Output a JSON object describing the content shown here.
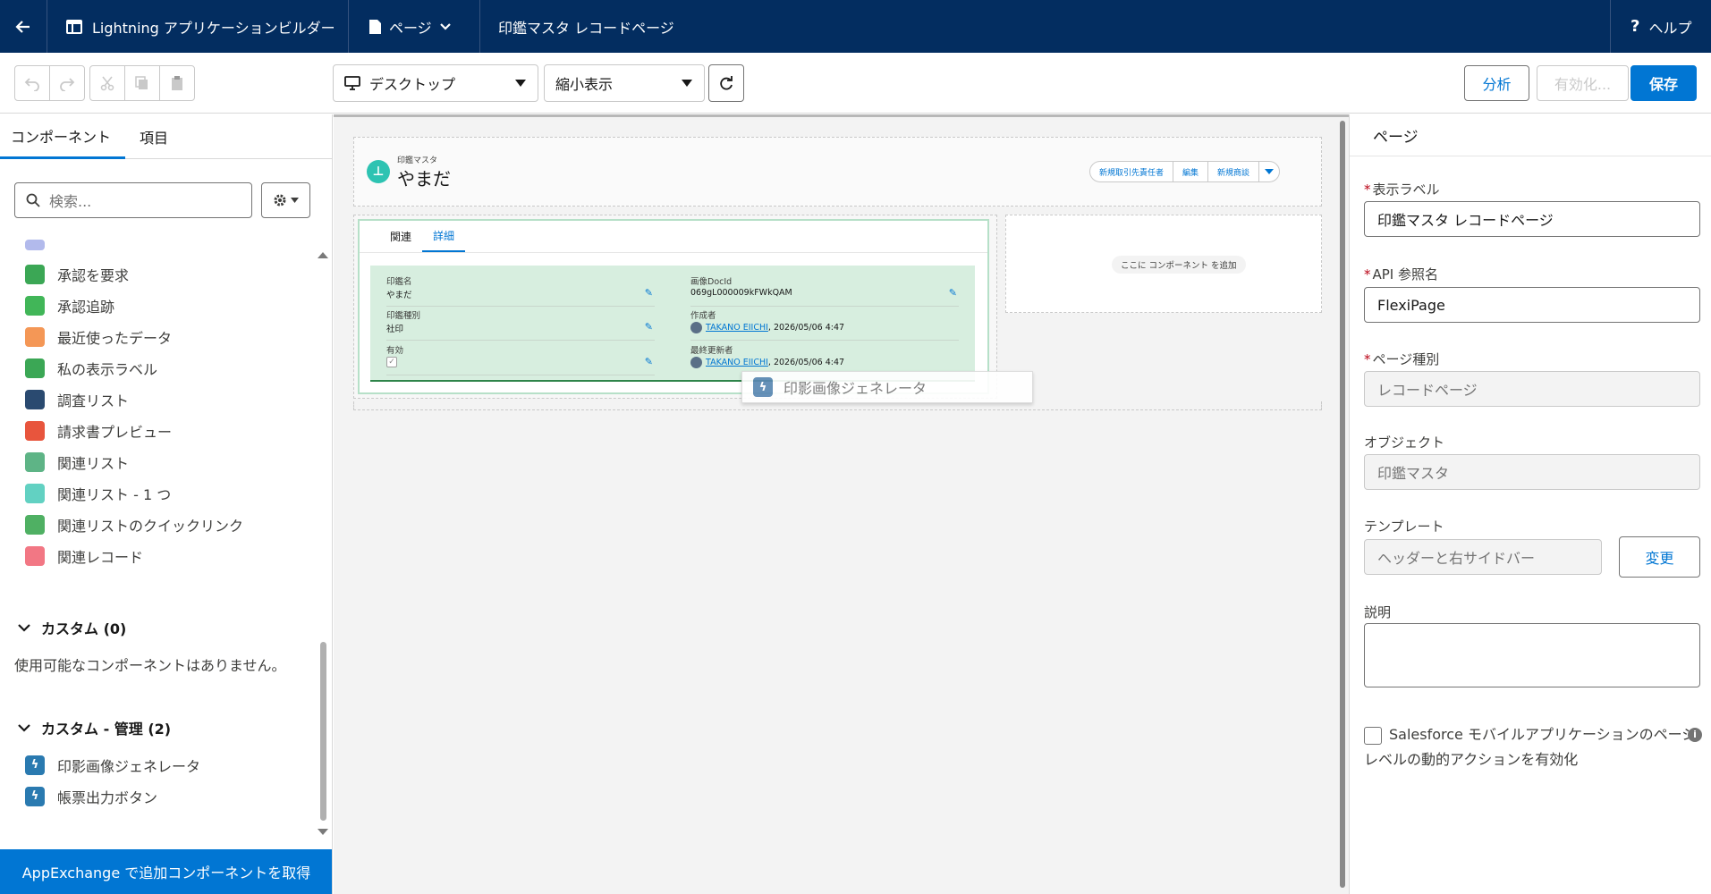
{
  "topbar": {
    "app_name": "Lightning アプリケーションビルダー",
    "page_menu": "ページ",
    "page_title": "印鑑マスタ レコードページ",
    "help": "ヘルプ",
    "bg_color": "#032d60"
  },
  "toolbar": {
    "device_select": "デスクトップ",
    "zoom_select": "縮小表示",
    "analyze": "分析",
    "activate": "有効化...",
    "save": "保存",
    "accent_color": "#0176d3"
  },
  "left": {
    "tabs": [
      "コンポーネント",
      "項目"
    ],
    "search_placeholder": "検索...",
    "items": [
      {
        "label": "承認を要求",
        "icon": "approval-icon",
        "color": "#3ba755"
      },
      {
        "label": "承認追跡",
        "icon": "clipboard-icon",
        "color": "#41b658"
      },
      {
        "label": "最近使ったデータ",
        "icon": "clock-icon",
        "color": "#f49756"
      },
      {
        "label": "私の表示ラベル",
        "icon": "tag-icon",
        "color": "#3ba755"
      },
      {
        "label": "調査リスト",
        "icon": "checkbox-icon",
        "color": "#2a4a70"
      },
      {
        "label": "請求書プレビュー",
        "icon": "invoice-icon",
        "color": "#e8553d"
      },
      {
        "label": "関連リスト",
        "icon": "related-list-icon",
        "color": "#5eb486"
      },
      {
        "label": "関連リスト - 1 つ",
        "icon": "related-list-single-icon",
        "color": "#62d1c2"
      },
      {
        "label": "関連リストのクイックリンク",
        "icon": "quick-links-icon",
        "color": "#4fb063"
      },
      {
        "label": "関連レコード",
        "icon": "related-record-icon",
        "color": "#f27784"
      }
    ],
    "custom_header": "カスタム (0)",
    "custom_empty": "使用可能なコンポーネントはありません。",
    "custom_managed_header": "カスタム - 管理 (2)",
    "custom_managed_items": [
      {
        "label": "印影画像ジェネレータ",
        "icon": "lightning-icon",
        "color": "#2a7ab0"
      },
      {
        "label": "帳票出力ボタン",
        "icon": "lightning-icon",
        "color": "#2a7ab0"
      }
    ],
    "appexchange": "AppExchange で追加コンポーネントを取得"
  },
  "canvas": {
    "highlights": {
      "object_label": "印鑑マスタ",
      "record_name": "やまだ",
      "actions": [
        "新規取引先責任者",
        "編集",
        "新規商談"
      ]
    },
    "tabs": [
      "関連",
      "詳細"
    ],
    "fields": {
      "name_label": "印鑑名",
      "name_value": "やまだ",
      "type_label": "印鑑種別",
      "type_value": "社印",
      "active_label": "有効",
      "docid_label": "画像DocId",
      "docid_value": "069gL000009kFWkQAM",
      "creator_label": "作成者",
      "creator_user": "TAKANO EIICHI",
      "creator_date": ", 2026/05/06 4:47",
      "modifier_label": "最終更新者",
      "modifier_user": "TAKANO EIICHI",
      "modifier_date": ", 2026/05/06 4:47"
    },
    "add_component": "ここに コンポーネント を追加",
    "drag_ghost": "印影画像ジェネレータ"
  },
  "right": {
    "header": "ページ",
    "label_label": "表示ラベル",
    "label_value": "印鑑マスタ レコードページ",
    "api_label": "API 参照名",
    "api_value": "FlexiPage",
    "type_label": "ページ種別",
    "type_value": "レコードページ",
    "object_label": "オブジェクト",
    "object_value": "印鑑マスタ",
    "template_label": "テンプレート",
    "template_value": "ヘッダーと右サイドバー",
    "change": "変更",
    "desc_label": "説明",
    "mobile_action": "Salesforce モバイルアプリケーションのページレベルの動的アクションを有効化"
  }
}
